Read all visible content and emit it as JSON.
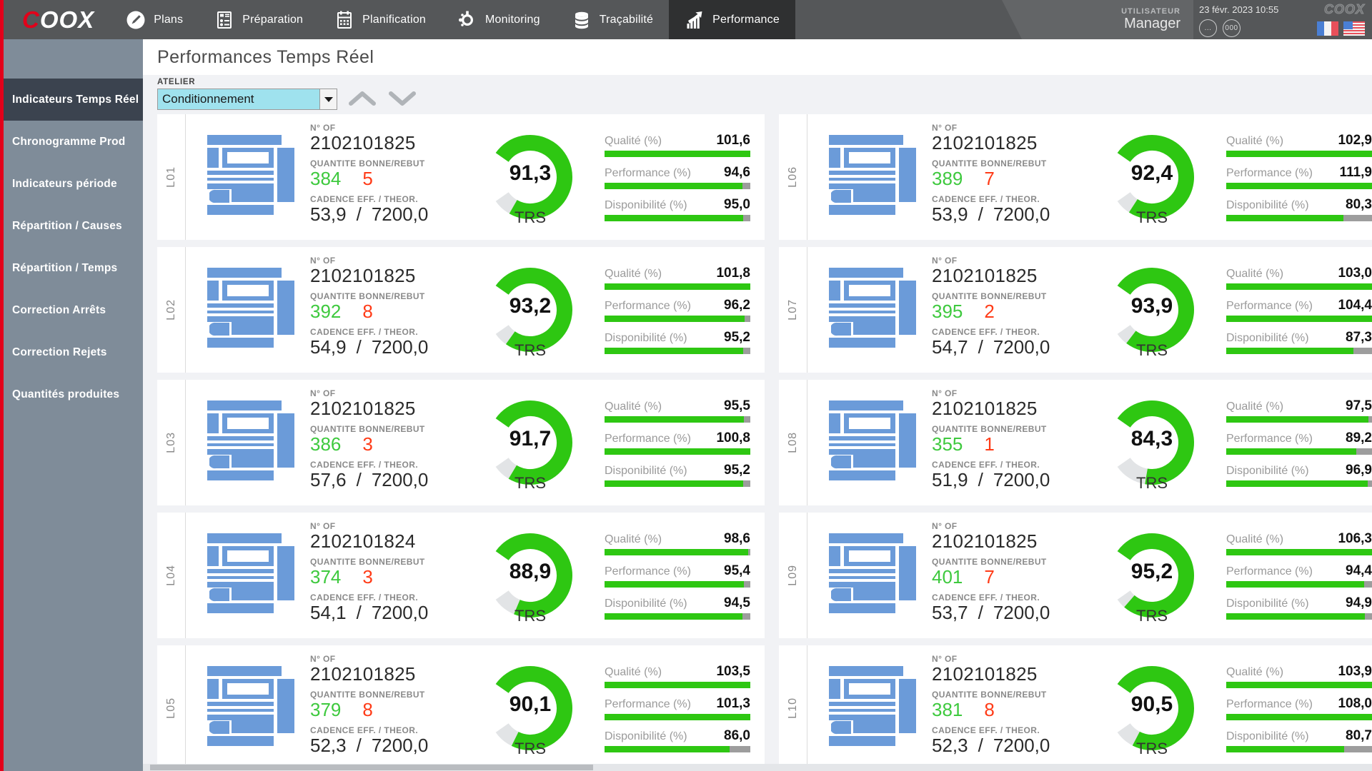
{
  "header": {
    "logo": "COOX",
    "nav": [
      {
        "label": "Plans",
        "icon": "pencil-circle-icon",
        "active": false
      },
      {
        "label": "Préparation",
        "icon": "list-form-icon",
        "active": false
      },
      {
        "label": "Planification",
        "icon": "calendar-icon",
        "active": false
      },
      {
        "label": "Monitoring",
        "icon": "network-nodes-icon",
        "active": false
      },
      {
        "label": "Traçabilité",
        "icon": "database-stack-icon",
        "active": false
      },
      {
        "label": "Performance",
        "icon": "bar-chart-arrow-icon",
        "active": true
      }
    ],
    "user_label": "UTILISATEUR",
    "user_name": "Manager",
    "datetime": "23 févr. 2023 10:55",
    "mini_logo": "COOX",
    "circle_icons": [
      "...",
      "000"
    ],
    "flags": [
      "flag-france-icon",
      "flag-usa-icon"
    ]
  },
  "sidebar": {
    "items": [
      {
        "label": "Indicateurs Temps Réel",
        "active": true
      },
      {
        "label": "Chronogramme Prod",
        "active": false
      },
      {
        "label": "Indicateurs période",
        "active": false
      },
      {
        "label": "Répartition / Causes",
        "active": false
      },
      {
        "label": "Répartition / Temps",
        "active": false
      },
      {
        "label": "Correction Arrêts",
        "active": false
      },
      {
        "label": "Correction Rejets",
        "active": false
      },
      {
        "label": "Quantités produites",
        "active": false
      }
    ]
  },
  "page": {
    "title": "Performances Temps Réel",
    "atelier_label": "ATELIER",
    "atelier_value": "Conditionnement",
    "nav_up_icon": "chevron-up-icon",
    "nav_down_icon": "chevron-down-icon"
  },
  "labels": {
    "of": "N° OF",
    "quantity": "QUANTITE BONNE/REBUT",
    "cadence": "CADENCE EFF. / THEOR.",
    "trs": "TRS",
    "quality": "Qualité (%)",
    "performance": "Performance (%)",
    "availability": "Disponibilité (%)",
    "slash": "/"
  },
  "colors": {
    "accent_red": "#e2001a",
    "green": "#2ec712",
    "good_qty": "#3ec93e",
    "bad_qty": "#ff3b17",
    "gauge_grey": "#e2e4e6",
    "bar_track": "#9d9d9d",
    "machine_blue": "#6b9bd9",
    "sidebar": "#7f8c99",
    "sidebar_active": "#3b434f",
    "topbar": "#555759",
    "select_cyan": "#9fe2ee"
  },
  "chart_data": {
    "type": "table",
    "title": "Performances Temps Réel — Conditionnement",
    "columns": [
      "line",
      "of_number",
      "qty_good",
      "qty_scrap",
      "cadence_eff",
      "cadence_theor",
      "trs",
      "quality",
      "performance",
      "availability"
    ],
    "rows": [
      {
        "line": "L01",
        "of_number": "2102101825",
        "qty_good": "384",
        "qty_scrap": "5",
        "cadence_eff": "53,9",
        "cadence_theor": "7200,0",
        "trs": "91,3",
        "quality": "101,6",
        "performance": "94,6",
        "availability": "95,0"
      },
      {
        "line": "L02",
        "of_number": "2102101825",
        "qty_good": "392",
        "qty_scrap": "8",
        "cadence_eff": "54,9",
        "cadence_theor": "7200,0",
        "trs": "93,2",
        "quality": "101,8",
        "performance": "96,2",
        "availability": "95,2"
      },
      {
        "line": "L03",
        "of_number": "2102101825",
        "qty_good": "386",
        "qty_scrap": "3",
        "cadence_eff": "57,6",
        "cadence_theor": "7200,0",
        "trs": "91,7",
        "quality": "95,5",
        "performance": "100,8",
        "availability": "95,2"
      },
      {
        "line": "L04",
        "of_number": "2102101824",
        "qty_good": "374",
        "qty_scrap": "3",
        "cadence_eff": "54,1",
        "cadence_theor": "7200,0",
        "trs": "88,9",
        "quality": "98,6",
        "performance": "95,4",
        "availability": "94,5"
      },
      {
        "line": "L05",
        "of_number": "2102101825",
        "qty_good": "379",
        "qty_scrap": "8",
        "cadence_eff": "52,3",
        "cadence_theor": "7200,0",
        "trs": "90,1",
        "quality": "103,5",
        "performance": "101,3",
        "availability": "86,0"
      },
      {
        "line": "L06",
        "of_number": "2102101825",
        "qty_good": "389",
        "qty_scrap": "7",
        "cadence_eff": "53,9",
        "cadence_theor": "7200,0",
        "trs": "92,4",
        "quality": "102,9",
        "performance": "111,9",
        "availability": "80,3"
      },
      {
        "line": "L07",
        "of_number": "2102101825",
        "qty_good": "395",
        "qty_scrap": "2",
        "cadence_eff": "54,7",
        "cadence_theor": "7200,0",
        "trs": "93,9",
        "quality": "103,0",
        "performance": "104,4",
        "availability": "87,3"
      },
      {
        "line": "L08",
        "of_number": "2102101825",
        "qty_good": "355",
        "qty_scrap": "1",
        "cadence_eff": "51,9",
        "cadence_theor": "7200,0",
        "trs": "84,3",
        "quality": "97,5",
        "performance": "89,2",
        "availability": "96,9"
      },
      {
        "line": "L09",
        "of_number": "2102101825",
        "qty_good": "401",
        "qty_scrap": "7",
        "cadence_eff": "53,7",
        "cadence_theor": "7200,0",
        "trs": "95,2",
        "quality": "106,3",
        "performance": "94,4",
        "availability": "94,9"
      },
      {
        "line": "L10",
        "of_number": "2102101825",
        "qty_good": "381",
        "qty_scrap": "8",
        "cadence_eff": "52,3",
        "cadence_theor": "7200,0",
        "trs": "90,5",
        "quality": "103,9",
        "performance": "108,0",
        "availability": "80,7"
      }
    ],
    "order": [
      "L01",
      "L06",
      "L02",
      "L07",
      "L03",
      "L08",
      "L04",
      "L09",
      "L05",
      "L10"
    ],
    "value_range": [
      0,
      100
    ],
    "unit": "%"
  }
}
